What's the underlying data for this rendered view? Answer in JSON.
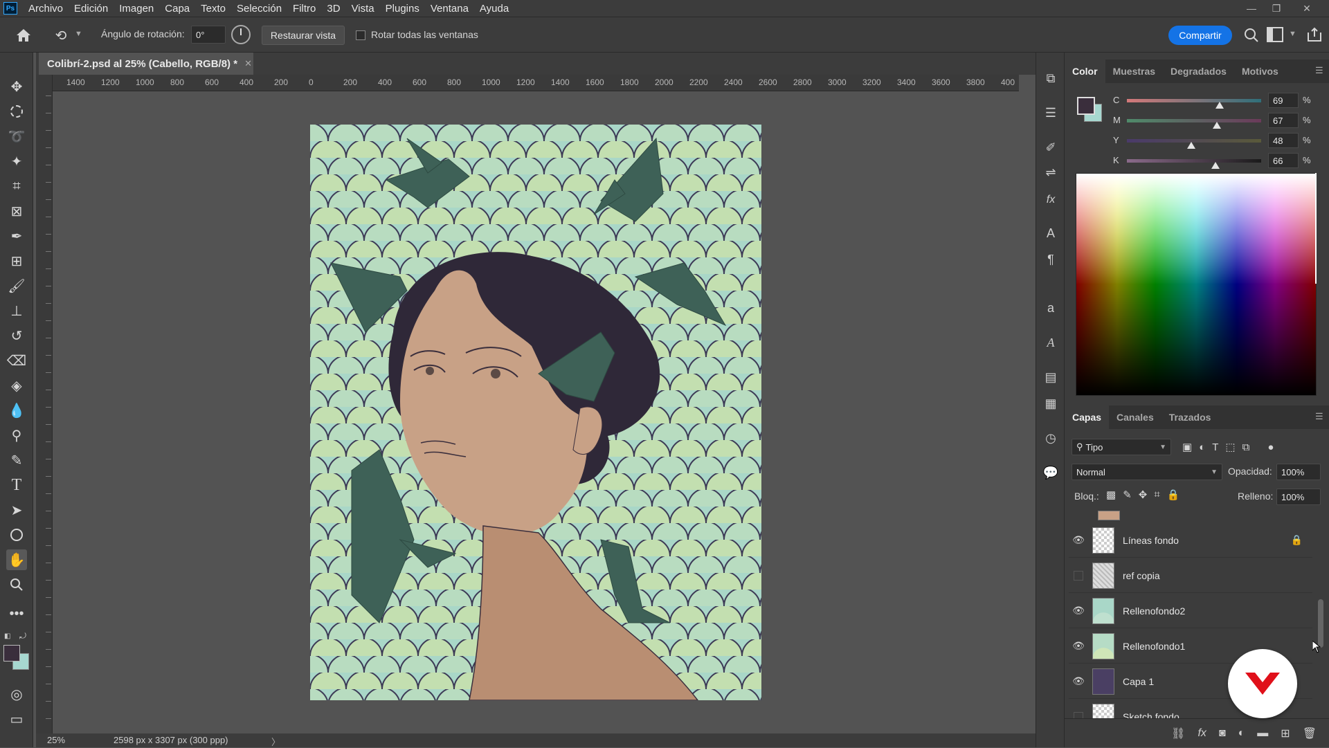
{
  "app": {
    "logo_text": "Ps",
    "menu": [
      "Archivo",
      "Edición",
      "Imagen",
      "Capa",
      "Texto",
      "Selección",
      "Filtro",
      "3D",
      "Vista",
      "Plugins",
      "Ventana",
      "Ayuda"
    ]
  },
  "options_bar": {
    "rotation_label": "Ángulo de rotación:",
    "rotation_value": "0°",
    "reset_view": "Restaurar vista",
    "rotate_all": "Rotar todas las ventanas",
    "share": "Compartir"
  },
  "document": {
    "tab_title": "Colibrí-2.psd al 25% (Cabello, RGB/8) *",
    "ruler_h": [
      "1400",
      "1200",
      "1000",
      "800",
      "600",
      "400",
      "200",
      "0",
      "200",
      "400",
      "600",
      "800",
      "1000",
      "1200",
      "1400",
      "1600",
      "1800",
      "2000",
      "2200",
      "2400",
      "2600",
      "2800",
      "3000",
      "3200",
      "3400",
      "3600",
      "3800",
      "400"
    ],
    "zoom": "25%",
    "size_info": "2598 px x 3307 px (300 ppp)"
  },
  "color_panel": {
    "tabs": [
      "Color",
      "Muestras",
      "Degradados",
      "Motivos"
    ],
    "active_tab": "Color",
    "foreground": "#3a2e3c",
    "background": "#a7d8d0",
    "channels": [
      {
        "label": "C",
        "value": "69",
        "unit": "%",
        "level": 0.69
      },
      {
        "label": "M",
        "value": "67",
        "unit": "%",
        "level": 0.67
      },
      {
        "label": "Y",
        "value": "48",
        "unit": "%",
        "level": 0.48
      },
      {
        "label": "K",
        "value": "66",
        "unit": "%",
        "level": 0.66
      }
    ]
  },
  "layers_panel": {
    "tabs": [
      "Capas",
      "Canales",
      "Trazados"
    ],
    "active_tab": "Capas",
    "filter_label": "Tipo",
    "blend_mode": "Normal",
    "opacity_label": "Opacidad:",
    "opacity_value": "100%",
    "lock_label": "Bloq.:",
    "fill_label": "Relleno:",
    "fill_value": "100%",
    "layers": [
      {
        "name": "Líneas fondo",
        "visible": true,
        "locked": true,
        "thumb": "checker"
      },
      {
        "name": "ref copia",
        "visible": false,
        "locked": false,
        "thumb": "sketch"
      },
      {
        "name": "Rellenofondo2",
        "visible": true,
        "locked": false,
        "thumb": "pattern"
      },
      {
        "name": "Rellenofondo1",
        "visible": true,
        "locked": false,
        "thumb": "pattern2"
      },
      {
        "name": "Capa 1",
        "visible": true,
        "locked": false,
        "thumb": "purple"
      },
      {
        "name": "Sketch fondo",
        "visible": false,
        "locked": false,
        "thumb": "checker"
      }
    ]
  },
  "colors": {
    "accent": "#1473e6",
    "panel": "#3c3c3c",
    "workspace": "#535353"
  }
}
